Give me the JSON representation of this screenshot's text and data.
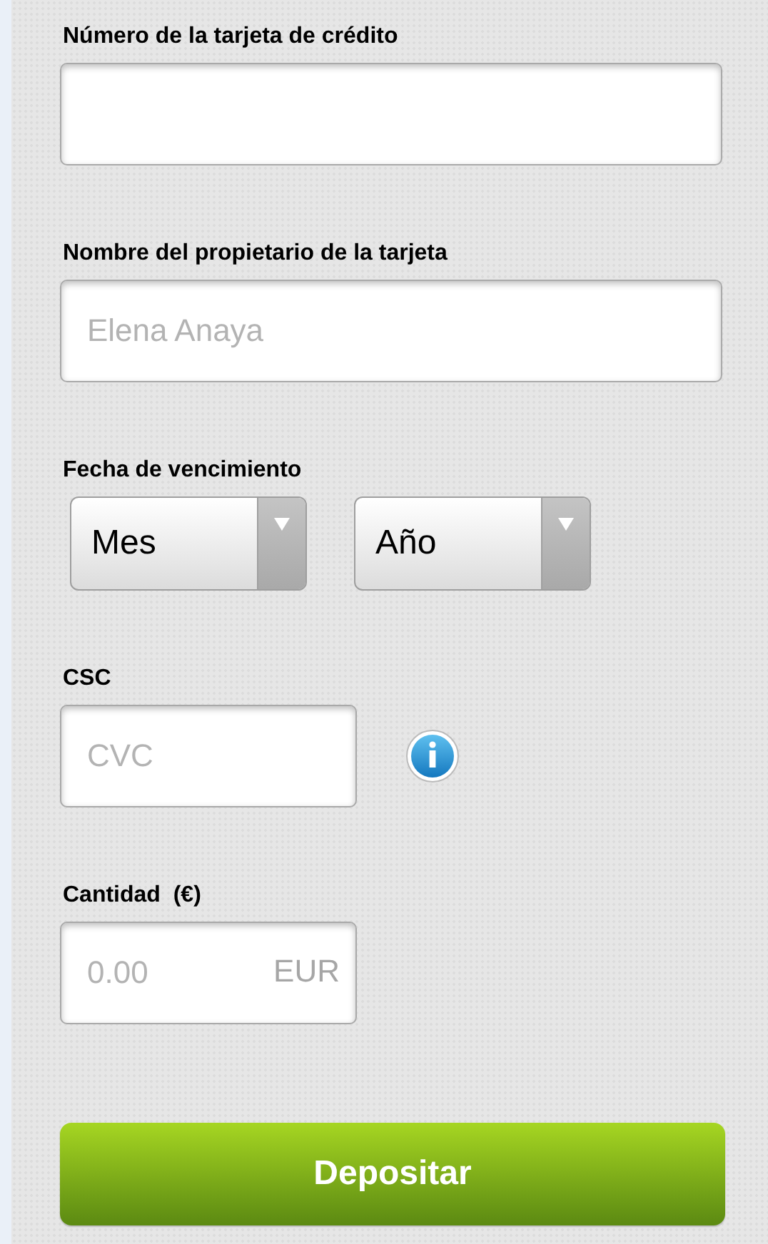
{
  "card_number": {
    "label": "Número de la tarjeta de crédito"
  },
  "cardholder": {
    "label": "Nombre del propietario de la tarjeta",
    "placeholder": "Elena Anaya"
  },
  "expiry": {
    "label": "Fecha de vencimiento",
    "selects": [
      {
        "value": "Mes"
      },
      {
        "value": "Año"
      }
    ]
  },
  "csc": {
    "label": "CSC",
    "placeholder": "CVC"
  },
  "amount": {
    "label": "Cantidad  (€)",
    "placeholder": "0.00",
    "suffix": "EUR"
  },
  "submit": {
    "label": "Depositar"
  }
}
